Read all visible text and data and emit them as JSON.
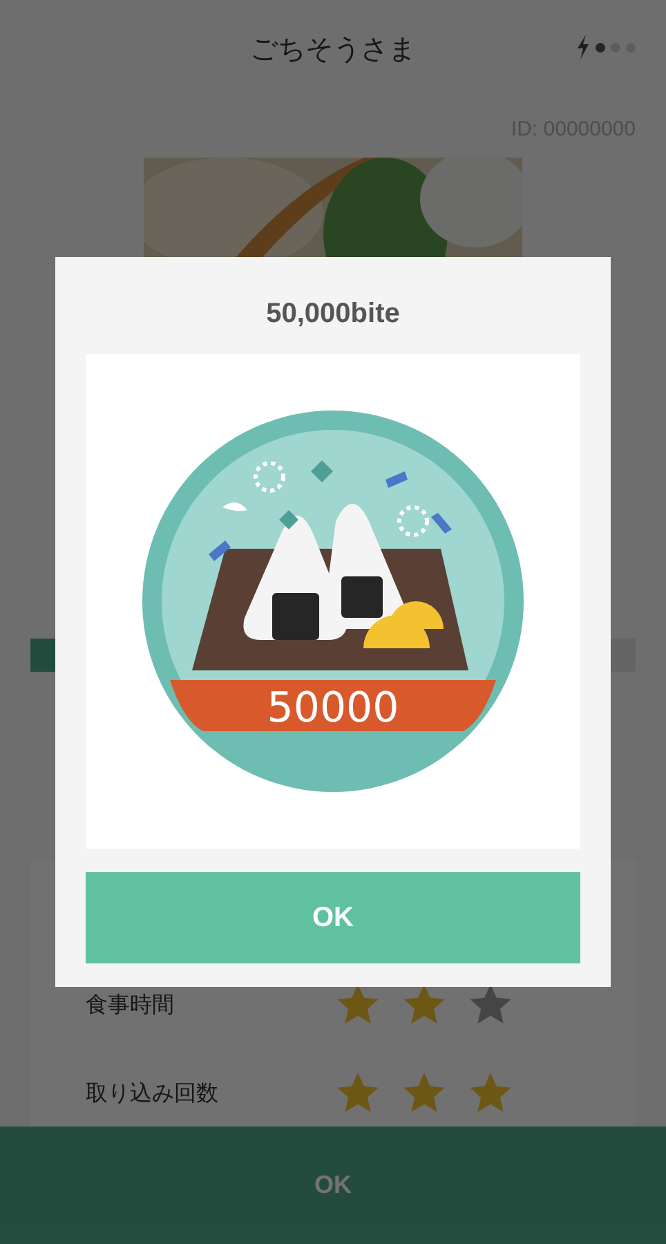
{
  "header": {
    "title": "ごちそうさま",
    "page_dots": [
      {
        "selected": true
      },
      {
        "selected": false
      },
      {
        "selected": false
      }
    ]
  },
  "record_id": "ID: 00000000",
  "ratings": [
    {
      "label": "食事時間",
      "stars": 2
    },
    {
      "label": "取り込み回数",
      "stars": 3
    }
  ],
  "bottom_button": "OK",
  "dialog": {
    "title": "50,000bite",
    "badge_number": "50000",
    "button": "OK"
  }
}
